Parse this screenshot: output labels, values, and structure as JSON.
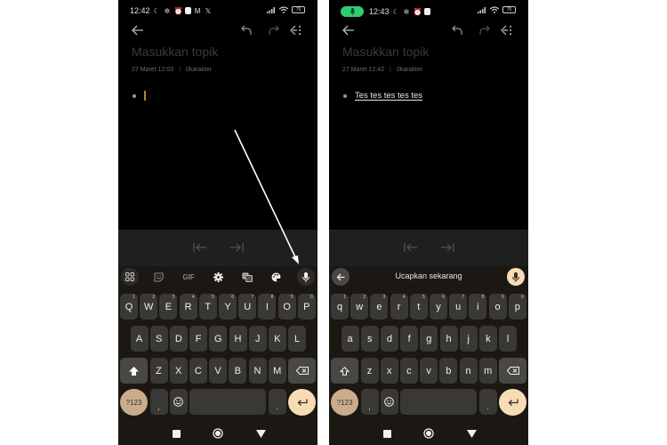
{
  "screens": [
    {
      "status": {
        "time": "12:42",
        "battery": "76",
        "recording": false
      },
      "toolbar": {
        "back": "back-arrow",
        "undo": "undo",
        "redo": "redo",
        "menu": "indent-menu"
      },
      "note": {
        "title_placeholder": "Masukkan topik",
        "date": "27 Maret 12:03",
        "separator": "|",
        "chars": "0karakter",
        "text": ""
      },
      "keyboard": {
        "mode": "typing",
        "toolbar_items": [
          "apps-grid",
          "sticker",
          "GIF",
          "settings",
          "translate",
          "palette",
          "mic"
        ],
        "gif_label": "GIF",
        "rows": [
          [
            {
              "k": "Q",
              "h": "1"
            },
            {
              "k": "W",
              "h": "2"
            },
            {
              "k": "E",
              "h": "3"
            },
            {
              "k": "R",
              "h": "4"
            },
            {
              "k": "T",
              "h": "5"
            },
            {
              "k": "Y",
              "h": "6"
            },
            {
              "k": "U",
              "h": "7"
            },
            {
              "k": "I",
              "h": "8"
            },
            {
              "k": "O",
              "h": "9"
            },
            {
              "k": "P",
              "h": "0"
            }
          ],
          [
            {
              "k": "A"
            },
            {
              "k": "S"
            },
            {
              "k": "D"
            },
            {
              "k": "F"
            },
            {
              "k": "G"
            },
            {
              "k": "H"
            },
            {
              "k": "J"
            },
            {
              "k": "K"
            },
            {
              "k": "L"
            }
          ],
          [
            {
              "k": "Z"
            },
            {
              "k": "X"
            },
            {
              "k": "C"
            },
            {
              "k": "V"
            },
            {
              "k": "B"
            },
            {
              "k": "N"
            },
            {
              "k": "M"
            }
          ]
        ],
        "symbols_label": "?123",
        "comma": ",",
        "period": "."
      }
    },
    {
      "status": {
        "time": "12:43",
        "battery": "76",
        "recording": true
      },
      "toolbar": {
        "back": "back-arrow",
        "undo": "undo",
        "redo": "redo",
        "menu": "indent-menu"
      },
      "note": {
        "title_placeholder": "Masukkan topik",
        "date": "27 Maret 12:42",
        "separator": "|",
        "chars": "0karakter",
        "text": "Tes tes tes tes tes"
      },
      "keyboard": {
        "mode": "voice",
        "voice_prompt": "Ucapkan sekarang",
        "rows": [
          [
            {
              "k": "q",
              "h": "1"
            },
            {
              "k": "w",
              "h": "2"
            },
            {
              "k": "e",
              "h": "3"
            },
            {
              "k": "r",
              "h": "4"
            },
            {
              "k": "t",
              "h": "5"
            },
            {
              "k": "y",
              "h": "6"
            },
            {
              "k": "u",
              "h": "7"
            },
            {
              "k": "i",
              "h": "8"
            },
            {
              "k": "o",
              "h": "9"
            },
            {
              "k": "p",
              "h": "0"
            }
          ],
          [
            {
              "k": "a"
            },
            {
              "k": "s"
            },
            {
              "k": "d"
            },
            {
              "k": "f"
            },
            {
              "k": "g"
            },
            {
              "k": "h"
            },
            {
              "k": "j"
            },
            {
              "k": "k"
            },
            {
              "k": "l"
            }
          ],
          [
            {
              "k": "z"
            },
            {
              "k": "x"
            },
            {
              "k": "c"
            },
            {
              "k": "v"
            },
            {
              "k": "b"
            },
            {
              "k": "n"
            },
            {
              "k": "m"
            }
          ]
        ],
        "symbols_label": "?123",
        "comma": ",",
        "period": "."
      }
    }
  ],
  "annotation": {
    "type": "arrow",
    "points_to": "mic-button",
    "color": "#ffffff"
  },
  "colors": {
    "keyboard_bg": "#1b1814",
    "key_bg": "#3a3834",
    "accent_sym": "#c9ac8c",
    "accent_enter": "#f7dcb5",
    "recording_pill": "#2ecc71",
    "cursor": "#b5852b"
  }
}
